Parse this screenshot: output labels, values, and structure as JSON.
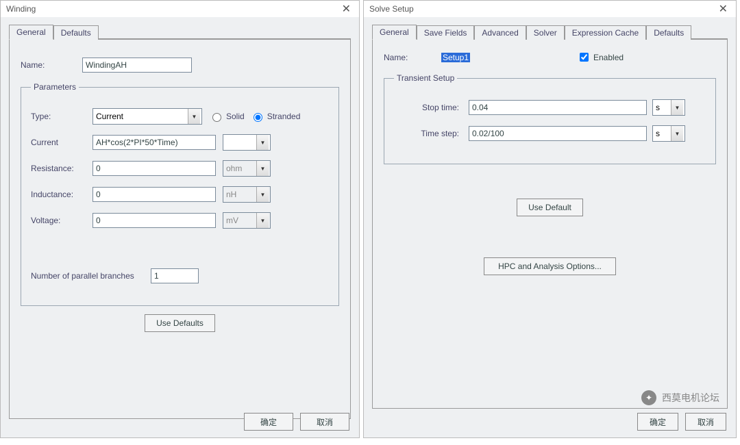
{
  "winding": {
    "title": "Winding",
    "tabs": [
      "General",
      "Defaults"
    ],
    "active_tab": 0,
    "name_label": "Name:",
    "name_value": "WindingAH",
    "params_legend": "Parameters",
    "type_label": "Type:",
    "type_value": "Current",
    "radio_solid": "Solid",
    "radio_stranded": "Stranded",
    "stranded_selected": true,
    "current_label": "Current",
    "current_value": "AH*cos(2*PI*50*Time)",
    "current_unit": "",
    "resistance_label": "Resistance:",
    "resistance_value": "0",
    "resistance_unit": "ohm",
    "inductance_label": "Inductance:",
    "inductance_value": "0",
    "inductance_unit": "nH",
    "voltage_label": "Voltage:",
    "voltage_value": "0",
    "voltage_unit": "mV",
    "branches_label": "Number of parallel branches",
    "branches_value": "1",
    "use_defaults": "Use Defaults",
    "ok": "确定",
    "cancel": "取消"
  },
  "solve": {
    "title": "Solve Setup",
    "tabs": [
      "General",
      "Save Fields",
      "Advanced",
      "Solver",
      "Expression Cache",
      "Defaults"
    ],
    "active_tab": 0,
    "name_label": "Name:",
    "name_value": "Setup1",
    "enabled_label": "Enabled",
    "enabled_checked": true,
    "transient_legend": "Transient Setup",
    "stop_label": "Stop time:",
    "stop_value": "0.04",
    "stop_unit": "s",
    "step_label": "Time step:",
    "step_value": "0.02/100",
    "step_unit": "s",
    "use_default": "Use Default",
    "hpc": "HPC and Analysis Options...",
    "ok": "确定",
    "cancel": "取消"
  },
  "watermark": "西莫电机论坛"
}
